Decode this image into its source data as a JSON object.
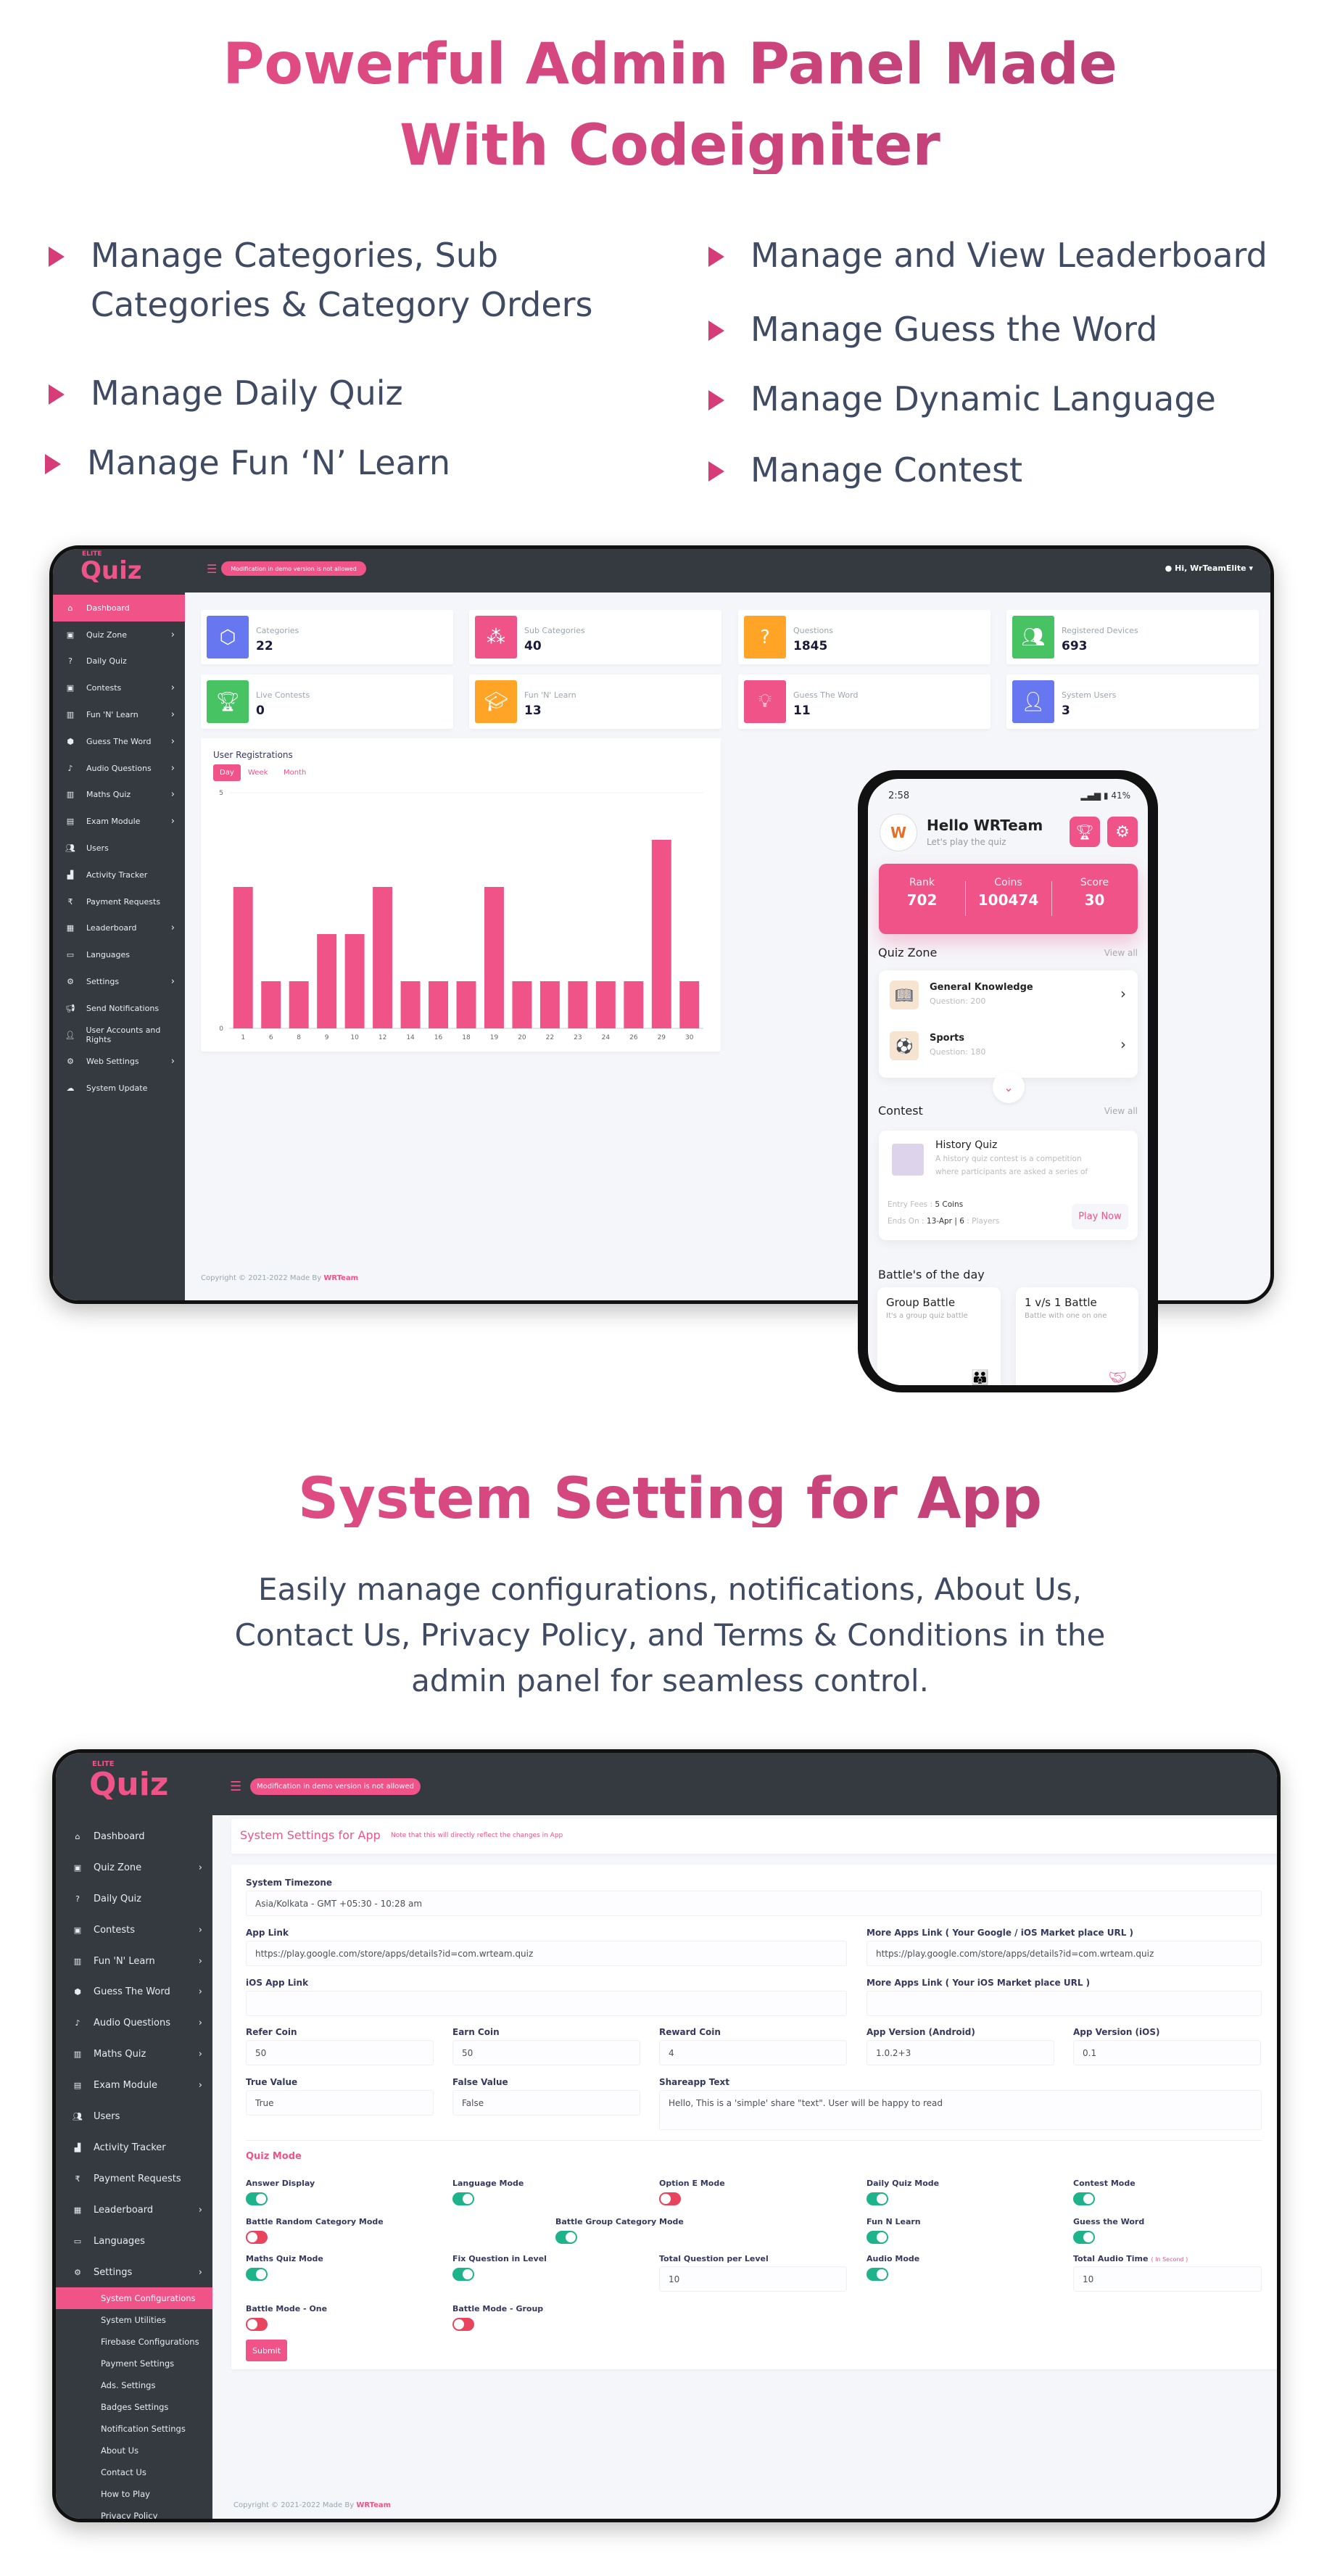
{
  "hero": {
    "title_line1": "Powerful Admin Panel Made",
    "title_line2": "With Codeigniter",
    "features_left": [
      "Manage Categories, Sub",
      "Categories & Category Orders",
      "Manage Daily Quiz",
      "Manage Fun ‘N’ Learn"
    ],
    "features_right": [
      "Manage and View Leaderboard",
      "Manage Guess the Word",
      "Manage Dynamic Language",
      "Manage Contest"
    ]
  },
  "colors": {
    "accent": "#ef5388",
    "sidebar": "#343a40",
    "toggle_on": "#1fb38b",
    "toggle_off": "#e8445d"
  },
  "dashboard": {
    "logo_small": "ELITE",
    "logo": "Quiz",
    "demo_notice": "Modification in demo version is not allowed",
    "user_menu": "Hi, WrTeamElite",
    "sidebar": [
      {
        "label": "Dashboard",
        "icon": "home-icon",
        "active": true
      },
      {
        "label": "Quiz Zone",
        "icon": "gift-icon",
        "sub": true
      },
      {
        "label": "Daily Quiz",
        "icon": "question-icon"
      },
      {
        "label": "Contests",
        "icon": "gift-icon",
        "sub": true
      },
      {
        "label": "Fun 'N' Learn",
        "icon": "book-icon",
        "sub": true
      },
      {
        "label": "Guess The Word",
        "icon": "cog-icon",
        "sub": true
      },
      {
        "label": "Audio Questions",
        "icon": "microphone-icon",
        "sub": true
      },
      {
        "label": "Maths Quiz",
        "icon": "book-icon",
        "sub": true
      },
      {
        "label": "Exam Module",
        "icon": "file-icon",
        "sub": true
      },
      {
        "label": "Users",
        "icon": "users-icon"
      },
      {
        "label": "Activity Tracker",
        "icon": "chart-icon"
      },
      {
        "label": "Payment Requests",
        "icon": "rupee-icon"
      },
      {
        "label": "Leaderboard",
        "icon": "grid-icon",
        "sub": true
      },
      {
        "label": "Languages",
        "icon": "language-icon"
      },
      {
        "label": "Settings",
        "icon": "gear-icon",
        "sub": true
      },
      {
        "label": "Send Notifications",
        "icon": "megaphone-icon"
      },
      {
        "label": "User Accounts and Rights",
        "icon": "user-icon"
      },
      {
        "label": "Web Settings",
        "icon": "gear-icon",
        "sub": true
      },
      {
        "label": "System Update",
        "icon": "cloud-icon"
      }
    ],
    "stats": [
      {
        "label": "Categories",
        "value": "22",
        "icon": "cube-icon",
        "color": "#6777ef"
      },
      {
        "label": "Sub Categories",
        "value": "40",
        "icon": "cubes-icon",
        "color": "#ef5388"
      },
      {
        "label": "Questions",
        "value": "1845",
        "icon": "question-circle-icon",
        "color": "#ffa426"
      },
      {
        "label": "Registered Devices",
        "value": "693",
        "icon": "users-icon",
        "color": "#47c363"
      },
      {
        "label": "Live Contests",
        "value": "0",
        "icon": "trophy-icon",
        "color": "#47c363"
      },
      {
        "label": "Fun 'N' Learn",
        "value": "13",
        "icon": "graduation-cap-icon",
        "color": "#ffa426"
      },
      {
        "label": "Guess The Word",
        "value": "11",
        "icon": "lightbulb-icon",
        "color": "#ef5388"
      },
      {
        "label": "System Users",
        "value": "3",
        "icon": "user-secret-icon",
        "color": "#6777ef"
      }
    ],
    "chart_tabs": [
      "Day",
      "Week",
      "Month"
    ],
    "footer_prefix": "Copyright © 2021-2022 Made By",
    "footer_brand": "WRTeam"
  },
  "chart_data": {
    "type": "bar",
    "title": "User Registrations",
    "categories": [
      "1",
      "6",
      "8",
      "9",
      "10",
      "12",
      "14",
      "16",
      "18",
      "19",
      "20",
      "22",
      "23",
      "24",
      "26",
      "29",
      "30"
    ],
    "values": [
      3,
      1,
      1,
      2,
      2,
      3,
      1,
      1,
      1,
      3,
      1,
      1,
      1,
      1,
      1,
      4,
      1
    ],
    "ylim": [
      0,
      5
    ],
    "yticks": [
      "0",
      "5"
    ],
    "color": "#ef5388",
    "grid": true
  },
  "phone": {
    "time": "2:58",
    "battery": "41%",
    "greeting": "Hello WRTeam",
    "subtitle": "Let's play the quiz",
    "stats": [
      {
        "label": "Rank",
        "value": "702"
      },
      {
        "label": "Coins",
        "value": "100474"
      },
      {
        "label": "Score",
        "value": "30"
      }
    ],
    "quiz_zone_title": "Quiz Zone",
    "view_all": "View all",
    "categories": [
      {
        "name": "General Knowledge",
        "count": "Question: 200"
      },
      {
        "name": "Sports",
        "count": "Question: 180"
      }
    ],
    "contest_title": "Contest",
    "contest": {
      "name": "History Quiz",
      "desc1": "A history quiz contest is a competition",
      "desc2": "where participants are asked a series of",
      "entry_label": "Entry Fees :",
      "entry_value": "5 Coins",
      "ends_label": "Ends On :",
      "ends_value": "13-Apr",
      "players_value": "6",
      "players_label": ": Players",
      "play": "Play Now"
    },
    "battles_title": "Battle's of the day",
    "battles": [
      {
        "name": "Group Battle",
        "desc": "It's a group quiz battle"
      },
      {
        "name": "1 v/s 1 Battle",
        "desc": "Battle with one on one"
      }
    ]
  },
  "section2": {
    "title": "System Setting for App",
    "desc": [
      "Easily manage configurations, notifications, About Us,",
      "Contact Us, Privacy Policy, and Terms & Conditions in the",
      "admin panel for seamless control."
    ]
  },
  "settings": {
    "sidebar": [
      {
        "label": "Dashboard",
        "icon": "home-icon"
      },
      {
        "label": "Quiz Zone",
        "icon": "gift-icon",
        "sub": true
      },
      {
        "label": "Daily Quiz",
        "icon": "question-icon"
      },
      {
        "label": "Contests",
        "icon": "gift-icon",
        "sub": true
      },
      {
        "label": "Fun 'N' Learn",
        "icon": "book-icon",
        "sub": true
      },
      {
        "label": "Guess The Word",
        "icon": "cog-icon",
        "sub": true
      },
      {
        "label": "Audio Questions",
        "icon": "microphone-icon",
        "sub": true
      },
      {
        "label": "Maths Quiz",
        "icon": "book-icon",
        "sub": true
      },
      {
        "label": "Exam Module",
        "icon": "file-icon",
        "sub": true
      },
      {
        "label": "Users",
        "icon": "users-icon"
      },
      {
        "label": "Activity Tracker",
        "icon": "chart-icon"
      },
      {
        "label": "Payment Requests",
        "icon": "rupee-icon"
      },
      {
        "label": "Leaderboard",
        "icon": "grid-icon",
        "sub": true
      },
      {
        "label": "Languages",
        "icon": "language-icon"
      },
      {
        "label": "Settings",
        "icon": "gear-icon",
        "sub": true
      }
    ],
    "submenu": [
      {
        "label": "System Configurations",
        "active": true
      },
      {
        "label": "System Utilities"
      },
      {
        "label": "Firebase Configurations"
      },
      {
        "label": "Payment Settings"
      },
      {
        "label": "Ads. Settings"
      },
      {
        "label": "Badges Settings"
      },
      {
        "label": "Notification Settings"
      },
      {
        "label": "About Us"
      },
      {
        "label": "Contact Us"
      },
      {
        "label": "How to Play"
      },
      {
        "label": "Privacy Policy"
      }
    ],
    "page_title": "System Settings for App",
    "page_note": "Note that this will directly reflect the changes in App",
    "fields": [
      {
        "label": "System Timezone",
        "value": "Asia/Kolkata - GMT +05:30 - 10:28 am"
      },
      {
        "label": "App Link",
        "value": "https://play.google.com/store/apps/details?id=com.wrteam.quiz"
      },
      {
        "label": "More Apps Link ( Your Google / iOS Market place URL )",
        "value": "https://play.google.com/store/apps/details?id=com.wrteam.quiz"
      },
      {
        "label": "iOS App Link",
        "value": ""
      },
      {
        "label": "More Apps Link ( Your iOS Market place URL )",
        "value": ""
      },
      {
        "label": "Refer Coin",
        "value": "50"
      },
      {
        "label": "Earn Coin",
        "value": "50"
      },
      {
        "label": "Reward Coin",
        "value": "4"
      },
      {
        "label": "App Version (Android)",
        "value": "1.0.2+3"
      },
      {
        "label": "App Version (iOS)",
        "value": "0.1"
      },
      {
        "label": "True Value",
        "value": "True"
      },
      {
        "label": "False Value",
        "value": "False"
      },
      {
        "label": "Shareapp Text",
        "value": "Hello, This is a 'simple' share \"text\". User will be happy to read"
      }
    ],
    "quiz_mode_title": "Quiz Mode",
    "toggles": [
      {
        "label": "Answer Display",
        "on": true
      },
      {
        "label": "Language Mode",
        "on": true
      },
      {
        "label": "Option E Mode",
        "on": false
      },
      {
        "label": "Daily Quiz Mode",
        "on": true
      },
      {
        "label": "Contest Mode",
        "on": true
      },
      {
        "label": "Battle Random Category Mode",
        "on": false
      },
      {
        "label": "Battle Group Category Mode",
        "on": true
      },
      {
        "label": "Fun N Learn",
        "on": true
      },
      {
        "label": "Guess the Word",
        "on": true
      },
      {
        "label": "Maths Quiz Mode",
        "on": true
      },
      {
        "label": "Fix Question in Level",
        "on": true
      },
      {
        "label": "Audio Mode",
        "on": true
      },
      {
        "label": "Battle Mode - One",
        "on": false
      },
      {
        "label": "Battle Mode - Group",
        "on": false
      }
    ],
    "total_question_label": "Total Question per Level",
    "total_question_value": "10",
    "audio_time_label": "Total Audio Time",
    "audio_time_unit": "( In Second )",
    "audio_time_value": "10",
    "submit": "Submit"
  }
}
